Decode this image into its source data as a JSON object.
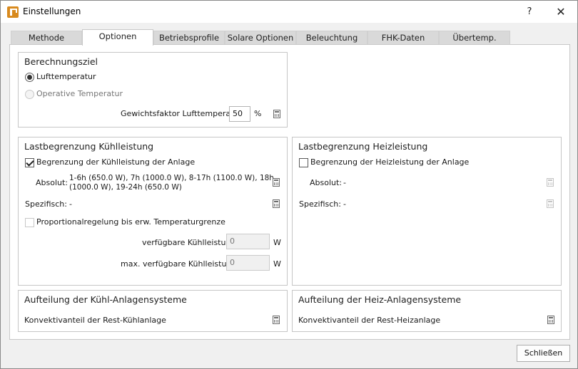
{
  "window": {
    "title": "Einstellungen",
    "help": "?",
    "close": "✕"
  },
  "tabs": [
    {
      "label": "Methode"
    },
    {
      "label": "Optionen"
    },
    {
      "label": "Betriebsprofile"
    },
    {
      "label": "Solare Optionen"
    },
    {
      "label": "Beleuchtung"
    },
    {
      "label": "FHK-Daten"
    },
    {
      "label": "Übertemp."
    }
  ],
  "berechnungsziel": {
    "title": "Berechnungsziel",
    "option1": "Lufttemperatur",
    "option2": "Operative Temperatur",
    "gewicht_label": "Gewichtsfaktor Lufttemperatur",
    "gewicht_value": "50",
    "gewicht_unit": "%"
  },
  "kuehl": {
    "title": "Lastbegrenzung Kühlleistung",
    "checkbox_label": "Begrenzung der Kühlleistung der Anlage",
    "absolut_label": "Absolut:",
    "absolut_value_line1": "1-6h (650.0 W), 7h (1000.0 W), 8-17h (1100.0 W), 18h",
    "absolut_value_line2": "(1000.0 W), 19-24h (650.0 W)",
    "spez_label": "Spezifisch:",
    "spez_value": "-",
    "prop_label": "Proportionalregelung bis erw. Temperaturgrenze",
    "verf_label": "verfügbare Kühlleistung",
    "verf_value": "0",
    "verf_unit": "W",
    "max_label": "max. verfügbare Kühlleistung",
    "max_value": "0",
    "max_unit": "W"
  },
  "heiz": {
    "title": "Lastbegrenzung Heizleistung",
    "checkbox_label": "Begrenzung der Heizleistung der Anlage",
    "absolut_label": "Absolut:",
    "absolut_value": "-",
    "spez_label": "Spezifisch:",
    "spez_value": "-"
  },
  "aufteilung_kuehl": {
    "title": "Aufteilung der Kühl-Anlagensysteme",
    "row_label": "Konvektivanteil der Rest-Kühlanlage"
  },
  "aufteilung_heiz": {
    "title": "Aufteilung der Heiz-Anlagensysteme",
    "row_label": "Konvektivanteil der Rest-Heizanlage"
  },
  "footer": {
    "close_label": "Schließen"
  },
  "colors": {
    "accent_icon": "#d88a1e",
    "tab_inactive": "#d9d9d9",
    "dialog_bg": "#f0f0f0"
  }
}
